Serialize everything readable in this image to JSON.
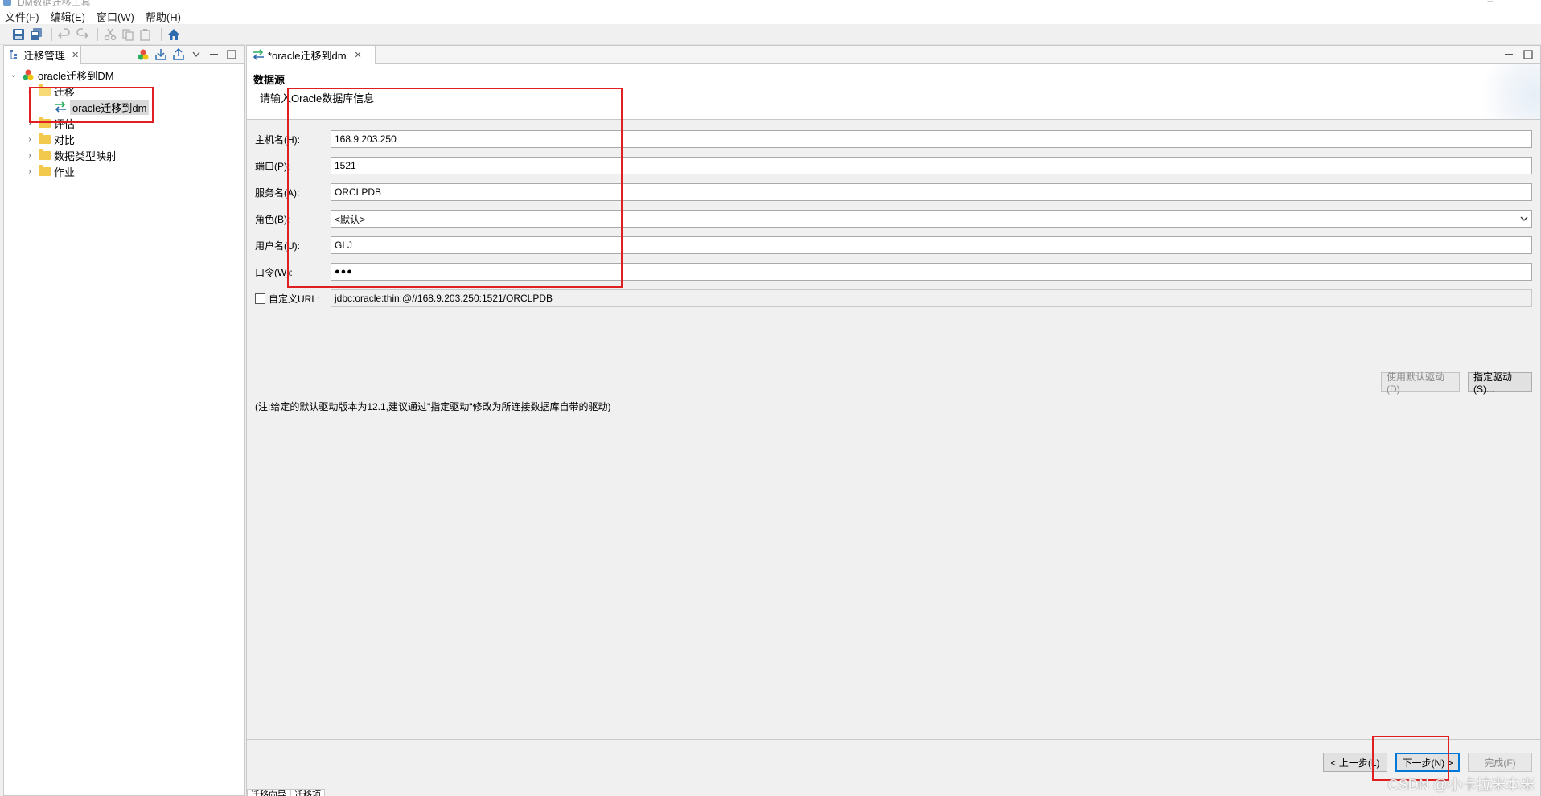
{
  "window": {
    "title": "DM数据迁移工具"
  },
  "menu": {
    "file": "文件(F)",
    "edit": "编辑(E)",
    "window": "窗口(W)",
    "help": "帮助(H)"
  },
  "toolbar": {
    "icons": [
      "save-icon",
      "save-all-icon",
      "undo-icon",
      "redo-icon",
      "cut-icon",
      "copy-icon",
      "paste-icon",
      "home-icon"
    ]
  },
  "left_panel": {
    "tab_label": "迁移管理",
    "tree": {
      "root": "oracle迁移到DM",
      "migrate": "迁移",
      "migrate_child": "oracle迁移到dm",
      "assess": "评估",
      "compare": "对比",
      "type_mapping": "数据类型映射",
      "job": "作业"
    }
  },
  "editor": {
    "tab_label": "*oracle迁移到dm",
    "header_title": "数据源",
    "header_desc": "请输入Oracle数据库信息",
    "form": {
      "host_label": "主机名(H):",
      "host_value": "168.9.203.250",
      "port_label": "端口(P):",
      "port_value": "1521",
      "service_label": "服务名(A):",
      "service_value": "ORCLPDB",
      "role_label": "角色(B):",
      "role_value": "<默认>",
      "user_label": "用户名(U):",
      "user_value": "GLJ",
      "password_label": "口令(W):",
      "password_value": "●●●",
      "custom_url_label": "自定义URL:",
      "custom_url_value": "jdbc:oracle:thin:@//168.9.203.250:1521/ORCLPDB"
    },
    "buttons": {
      "default_driver": "使用默认驱动(D)",
      "specify_driver": "指定驱动(S)...",
      "prev": "< 上一步(L)",
      "next": "下一步(N) >",
      "finish": "完成(F)"
    },
    "note": "(注:给定的默认驱动版本为12.1,建议通过\"指定驱动\"修改为所连接数据库自带的驱动)",
    "bottom_tabs": [
      "迁移向导",
      "迁移项"
    ]
  },
  "watermark": "CSDN @小卡拉米本米",
  "colors": {
    "annotation": "#e02020",
    "folder": "#f2c94c",
    "accent": "#0078d7"
  }
}
